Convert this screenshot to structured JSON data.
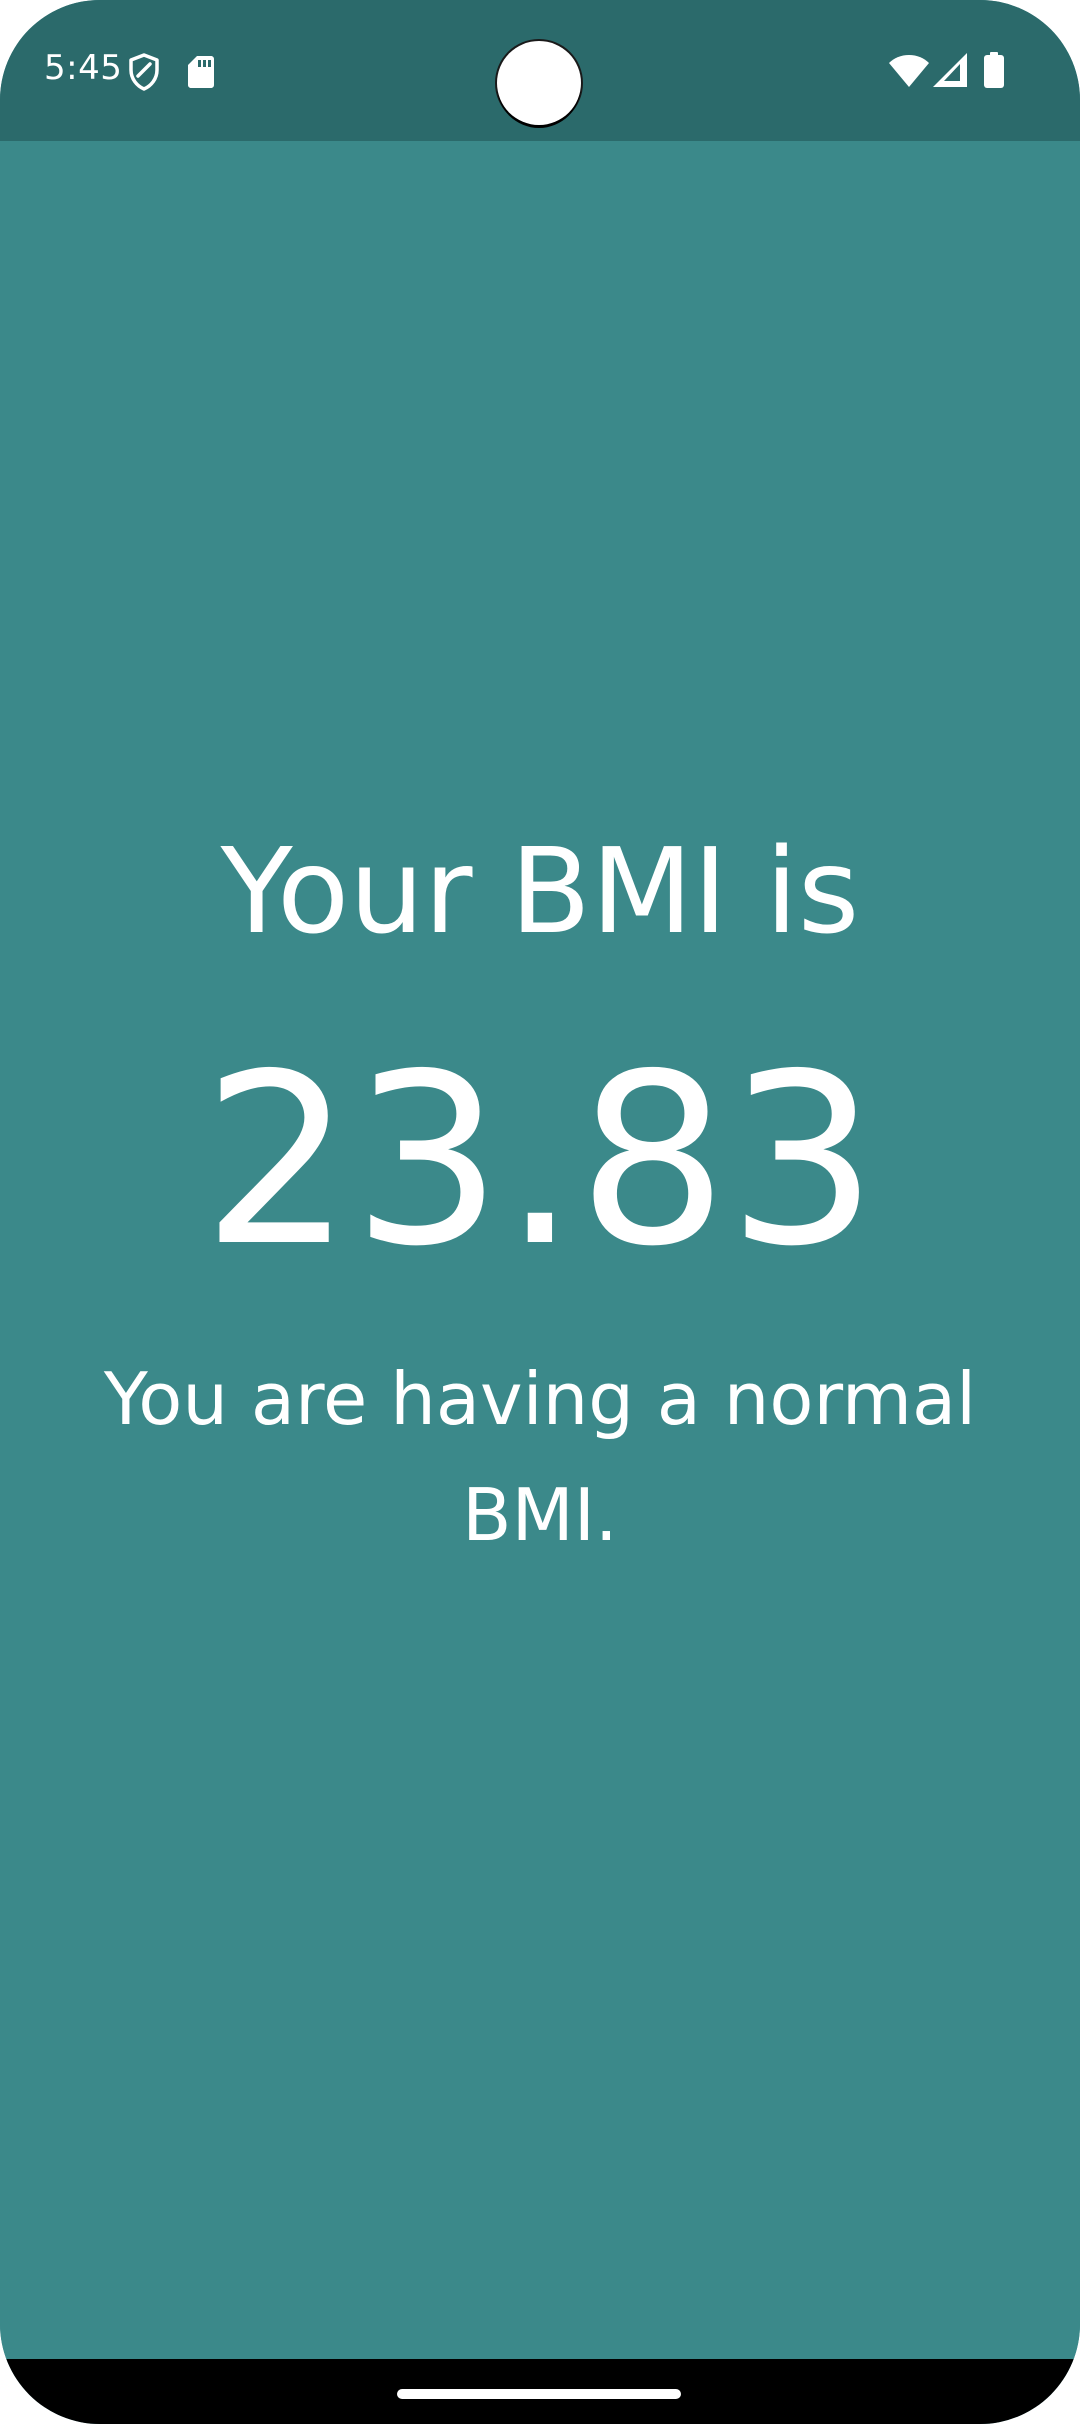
{
  "status_bar": {
    "time": "5:45",
    "icons": [
      "shield-icon",
      "sd-card-icon",
      "wifi-icon",
      "cellular-signal-icon",
      "battery-icon"
    ]
  },
  "result": {
    "heading": "Your BMI is",
    "value": "23.83",
    "message": "You are having a normal BMI."
  },
  "colors": {
    "status_bar": "#2b6a6b",
    "background": "#3b898a",
    "text": "#ffffff",
    "nav_bar": "#000000"
  }
}
